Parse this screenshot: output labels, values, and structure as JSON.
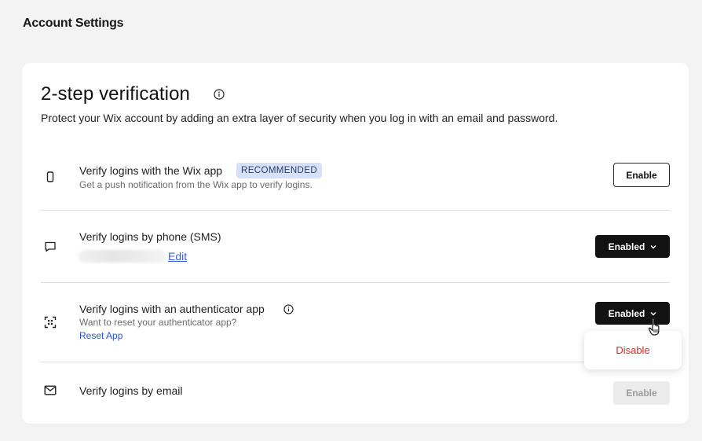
{
  "header": {
    "title": "Account Settings"
  },
  "card": {
    "title": "2-step verification",
    "description": "Protect your Wix account by adding an extra layer of security when you log in with an email and password."
  },
  "methods": [
    {
      "title": "Verify logins with the Wix app",
      "badge": "RECOMMENDED",
      "subtitle": "Get a push notification from the Wix app to verify logins.",
      "button": "Enable",
      "icon": "phone-icon"
    },
    {
      "title": "Verify logins by phone (SMS)",
      "link": "Edit",
      "button": "Enabled",
      "icon": "message-icon"
    },
    {
      "title": "Verify logins with an authenticator app",
      "subtitle": "Want to reset your authenticator app?",
      "link": "Reset App",
      "button": "Enabled",
      "icon": "scan-icon"
    },
    {
      "title": "Verify logins by email",
      "button": "Enable",
      "icon": "mail-icon"
    }
  ],
  "dropdown": {
    "items": [
      "Disable"
    ]
  },
  "colors": {
    "accent_dark": "#121212",
    "link": "#3b5bdb",
    "danger": "#d22c2c",
    "badge_bg": "#d6e0fb"
  }
}
